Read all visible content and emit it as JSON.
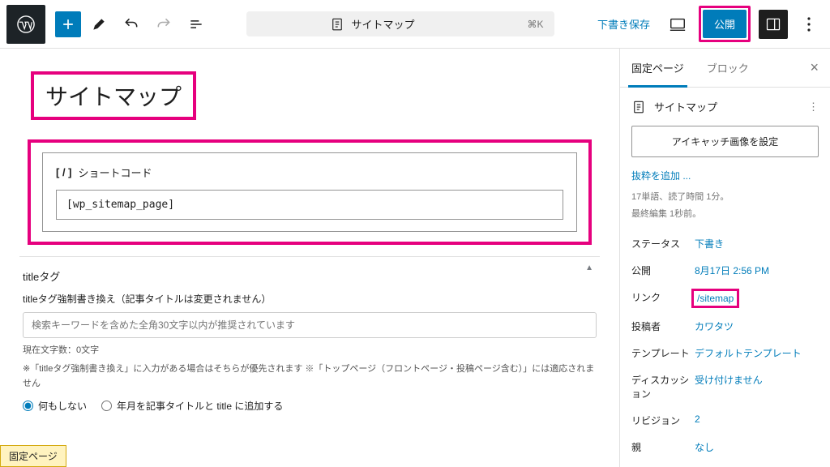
{
  "topbar": {
    "doc_title": "サイトマップ",
    "shortcut": "⌘K",
    "draft_save": "下書き保存",
    "publish": "公開"
  },
  "editor": {
    "page_title": "サイトマップ",
    "block_label": "ショートコード",
    "shortcode_value": "[wp_sitemap_page]"
  },
  "meta": {
    "title": "titleタグ",
    "desc": "titleタグ強制書き換え（記事タイトルは変更されません）",
    "placeholder": "検索キーワードを含めた全角30文字以内が推奨されています",
    "count": "現在文字数：0文字",
    "help": "※「titleタグ強制書き換え」に入力がある場合はそちらが優先されます ※「トップページ（フロントページ・投稿ページ含む）」には適応されません",
    "radio1": "何もしない",
    "radio2": "年月を記事タイトルと title に追加する"
  },
  "footer_tab": "固定ページ",
  "sidebar": {
    "tab_page": "固定ページ",
    "tab_block": "ブロック",
    "header_title": "サイトマップ",
    "featured": "アイキャッチ画像を設定",
    "excerpt_link": "抜粋を追加 ...",
    "stats_line1": "17単語、読了時間 1分。",
    "stats_line2": "最終編集 1秒前。",
    "rows": {
      "status_k": "ステータス",
      "status_v": "下書き",
      "publish_k": "公開",
      "publish_v": "8月17日 2:56 PM",
      "link_k": "リンク",
      "link_v": "/sitemap",
      "author_k": "投稿者",
      "author_v": "カワタツ",
      "template_k": "テンプレート",
      "template_v": "デフォルトテンプレート",
      "discuss_k": "ディスカッション",
      "discuss_v": "受け付けません",
      "revision_k": "リビジョン",
      "revision_v": "2",
      "parent_k": "親",
      "parent_v": "なし"
    }
  }
}
